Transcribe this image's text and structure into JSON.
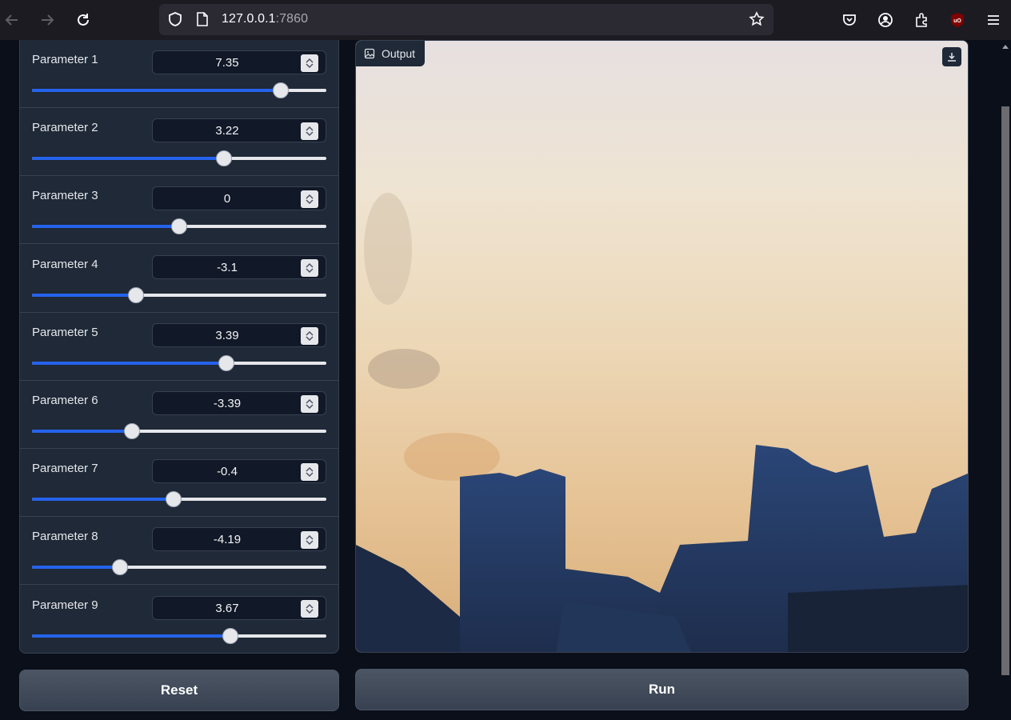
{
  "browser": {
    "url_host": "127.0.0.1",
    "url_port": ":7860",
    "icons": [
      "back-arrow-icon",
      "forward-arrow-icon",
      "reload-icon",
      "shield-icon",
      "page-icon",
      "star-icon",
      "pocket-icon",
      "account-icon",
      "extensions-icon",
      "ublock-icon",
      "menu-icon"
    ]
  },
  "parameters": [
    {
      "label": "Parameter 1",
      "value": "7.35",
      "fraction": 0.846
    },
    {
      "label": "Parameter 2",
      "value": "3.22",
      "fraction": 0.652
    },
    {
      "label": "Parameter 3",
      "value": "0",
      "fraction": 0.5
    },
    {
      "label": "Parameter 4",
      "value": "-3.1",
      "fraction": 0.353
    },
    {
      "label": "Parameter 5",
      "value": "3.39",
      "fraction": 0.66
    },
    {
      "label": "Parameter 6",
      "value": "-3.39",
      "fraction": 0.34
    },
    {
      "label": "Parameter 7",
      "value": "-0.4",
      "fraction": 0.48
    },
    {
      "label": "Parameter 8",
      "value": "-4.19",
      "fraction": 0.3
    },
    {
      "label": "Parameter 9",
      "value": "3.67",
      "fraction": 0.673
    }
  ],
  "output": {
    "label": "Output",
    "image_description_icon": "image-icon"
  },
  "buttons": {
    "reset": "Reset",
    "run": "Run"
  },
  "colors": {
    "accent": "#2563eb",
    "panel": "#1f2937",
    "background": "#0b0f19"
  }
}
